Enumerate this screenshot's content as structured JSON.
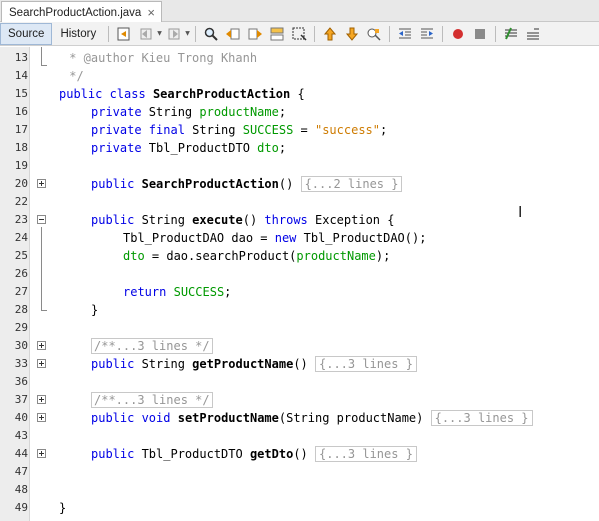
{
  "tab": {
    "title": "SearchProductAction.java",
    "close_glyph": "×"
  },
  "toolbar": {
    "source_label": "Source",
    "history_label": "History"
  },
  "colors": {
    "keyword": "#0000e6",
    "string": "#ce7b00",
    "field": "#009900",
    "comment": "#969696",
    "stop": "#d32f2f"
  },
  "code": {
    "l13": {
      "n": "13",
      "comment": " * @author Kieu Trong Khanh"
    },
    "l14": {
      "n": "14",
      "comment": " */"
    },
    "l15": {
      "n": "15",
      "kw": "public class",
      "name": "SearchProductAction",
      "rest": " {"
    },
    "l16": {
      "n": "16",
      "kw": "private",
      "type": " String ",
      "field": "productName",
      "rest": ";"
    },
    "l17": {
      "n": "17",
      "kw": "private final",
      "type": " String ",
      "field": "SUCCESS",
      "eq": " = ",
      "str": "\"success\"",
      "rest": ";"
    },
    "l18": {
      "n": "18",
      "kw": "private",
      "type": " Tbl_ProductDTO ",
      "field": "dto",
      "rest": ";"
    },
    "l19": {
      "n": "19"
    },
    "l20": {
      "n": "20",
      "kw": "public",
      "name": "SearchProductAction",
      "rest": "()",
      "collapsed": "{...2 lines }"
    },
    "l22": {
      "n": "22"
    },
    "l23": {
      "n": "23",
      "kw": "public",
      "type": " String ",
      "name": "execute",
      "rest": "() ",
      "kw2": "throws",
      "rest2": " Exception {"
    },
    "l24": {
      "n": "24",
      "pre": "Tbl_ProductDAO dao = ",
      "kw": "new",
      "rest": " Tbl_ProductDAO();"
    },
    "l25": {
      "n": "25",
      "field": "dto",
      "pre": " = dao.searchProduct(",
      "field2": "productName",
      "rest": ");"
    },
    "l26": {
      "n": "26"
    },
    "l27": {
      "n": "27",
      "kw": "return",
      "field": "SUCCESS",
      "rest": ";"
    },
    "l28": {
      "n": "28",
      "rest": "}"
    },
    "l29": {
      "n": "29"
    },
    "l30": {
      "n": "30",
      "collapsed": "/**...3 lines */"
    },
    "l33": {
      "n": "33",
      "kw": "public",
      "type": " String ",
      "name": "getProductName",
      "rest": "()",
      "collapsed": "{...3 lines }"
    },
    "l36": {
      "n": "36"
    },
    "l37": {
      "n": "37",
      "collapsed": "/**...3 lines */"
    },
    "l40": {
      "n": "40",
      "kw": "public void",
      "name": "setProductName",
      "rest": "(String productName)",
      "collapsed": "{...3 lines }"
    },
    "l43": {
      "n": "43"
    },
    "l44": {
      "n": "44",
      "kw": "public",
      "type": " Tbl_ProductDTO ",
      "name": "getDto",
      "rest": "()",
      "collapsed": "{...3 lines }"
    },
    "l47": {
      "n": "47"
    },
    "l48": {
      "n": "48"
    },
    "l49": {
      "n": "49",
      "rest": "}"
    }
  }
}
